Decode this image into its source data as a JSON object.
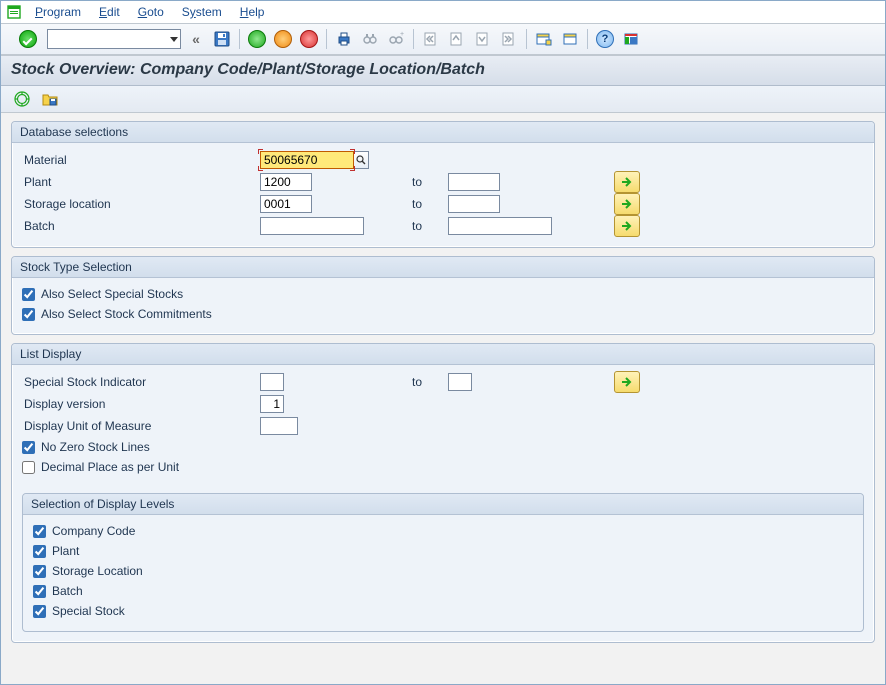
{
  "menu": {
    "program": "Program",
    "edit": "Edit",
    "goto": "Goto",
    "system": "System",
    "help": "Help"
  },
  "toolbar": {
    "combo_value": ""
  },
  "title": "Stock Overview: Company Code/Plant/Storage Location/Batch",
  "groups": {
    "db": {
      "title": "Database selections",
      "material_label": "Material",
      "material_value": "50065670",
      "plant_label": "Plant",
      "plant_value": "1200",
      "sloc_label": "Storage location",
      "sloc_value": "0001",
      "batch_label": "Batch",
      "batch_value": "",
      "to_label": "to"
    },
    "stocktype": {
      "title": "Stock Type Selection",
      "special": "Also Select Special Stocks",
      "commit": "Also Select Stock Commitments"
    },
    "list": {
      "title": "List Display",
      "ssi_label": "Special Stock Indicator",
      "ssi_value": "",
      "to_label": "to",
      "dv_label": "Display version",
      "dv_value": "1",
      "uom_label": "Display Unit of Measure",
      "uom_value": "",
      "nozero": "No Zero Stock Lines",
      "decimal": "Decimal Place as per Unit",
      "levels_title": "Selection of Display Levels",
      "lvl_cc": "Company Code",
      "lvl_plant": "Plant",
      "lvl_sloc": "Storage Location",
      "lvl_batch": "Batch",
      "lvl_ss": "Special Stock"
    }
  }
}
